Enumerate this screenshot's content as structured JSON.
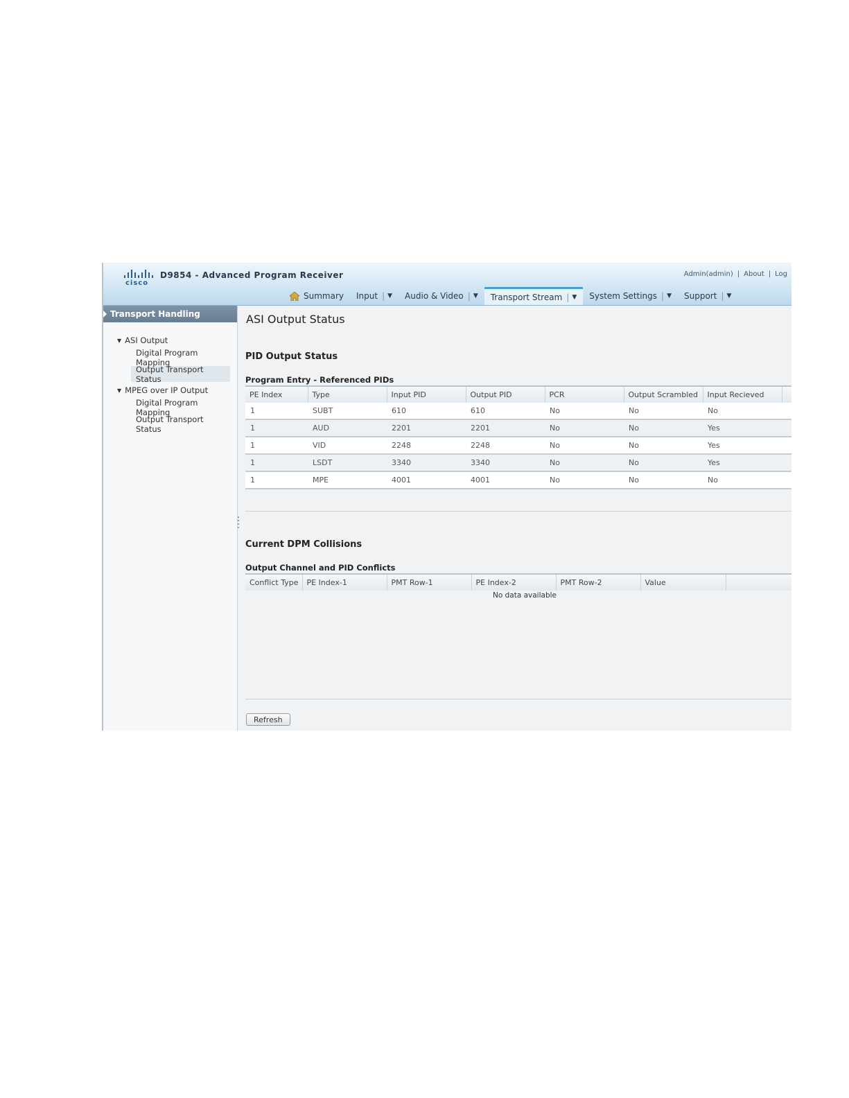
{
  "app": {
    "brand": "cisco",
    "product_title": "D9854 - Advanced Program Receiver",
    "user_links": [
      "Admin(admin)",
      "About",
      "Log"
    ]
  },
  "nav": [
    {
      "label": "Summary",
      "icon": "home-icon",
      "dropdown": false,
      "active": false
    },
    {
      "label": "Input",
      "dropdown": true,
      "active": false
    },
    {
      "label": "Audio & Video",
      "dropdown": true,
      "active": false
    },
    {
      "label": "Transport Stream",
      "dropdown": true,
      "active": true
    },
    {
      "label": "System Settings",
      "dropdown": true,
      "active": false
    },
    {
      "label": "Support",
      "dropdown": true,
      "active": false
    }
  ],
  "sidebar": {
    "header": "Transport Handling",
    "groups": [
      {
        "label": "ASI Output",
        "items": [
          "Digital Program Mapping",
          "Output Transport Status"
        ],
        "selected": 1
      },
      {
        "label": "MPEG over IP Output",
        "items": [
          "Digital Program Mapping",
          "Output Transport Status"
        ],
        "selected": -1
      }
    ]
  },
  "main": {
    "page_title": "ASI Output Status",
    "pid_section_title": "PID Output Status",
    "pid_table_title": "Program Entry - Referenced PIDs",
    "pid_columns": [
      "PE Index",
      "Type",
      "Input PID",
      "Output PID",
      "PCR",
      "Output Scrambled",
      "Input Recieved"
    ],
    "pid_rows": [
      [
        "1",
        "SUBT",
        "610",
        "610",
        "No",
        "No",
        "No"
      ],
      [
        "1",
        "AUD",
        "2201",
        "2201",
        "No",
        "No",
        "Yes"
      ],
      [
        "1",
        "VID",
        "2248",
        "2248",
        "No",
        "No",
        "Yes"
      ],
      [
        "1",
        "LSDT",
        "3340",
        "3340",
        "No",
        "No",
        "Yes"
      ],
      [
        "1",
        "MPE",
        "4001",
        "4001",
        "No",
        "No",
        "No"
      ]
    ],
    "dpm_section_title": "Current DPM Collisions",
    "conflict_table_title": "Output Channel and PID Conflicts",
    "conflict_columns": [
      "Conflict Type",
      "PE Index-1",
      "PMT Row-1",
      "PE Index-2",
      "PMT Row-2",
      "Value"
    ],
    "conflict_empty": "No data available",
    "refresh_label": "Refresh"
  }
}
